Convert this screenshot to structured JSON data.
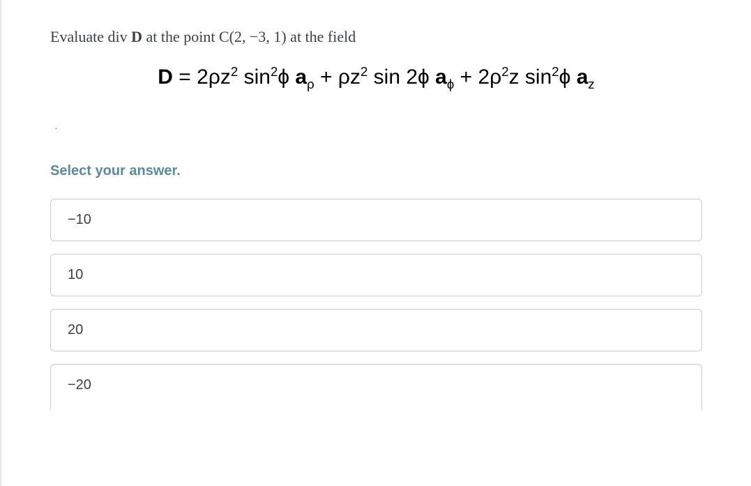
{
  "question": {
    "prompt_prefix": "Evaluate div ",
    "prompt_bold": "D",
    "prompt_suffix": " at the point C(2, −3, 1) at the field",
    "equation_parts": {
      "lhs": "D",
      "equals": " = ",
      "t1_a": "2ρz",
      "t1_exp1": "2",
      "t1_b": " sin",
      "t1_exp2": "2",
      "t1_c": "ϕ ",
      "t1_vec": "a",
      "t1_sub": "ρ",
      "plus1": " + ",
      "t2_a": "ρz",
      "t2_exp1": "2",
      "t2_b": " sin 2ϕ ",
      "t2_vec": "a",
      "t2_sub": "ϕ",
      "plus2": " + ",
      "t3_a": "2ρ",
      "t3_exp1": "2",
      "t3_b": "z sin",
      "t3_exp2": "2",
      "t3_c": "ϕ ",
      "t3_vec": "a",
      "t3_sub": "z"
    }
  },
  "select_label": "Select your answer.",
  "answers": [
    {
      "label": "−10"
    },
    {
      "label": "10"
    },
    {
      "label": "20"
    },
    {
      "label": "−20"
    }
  ]
}
